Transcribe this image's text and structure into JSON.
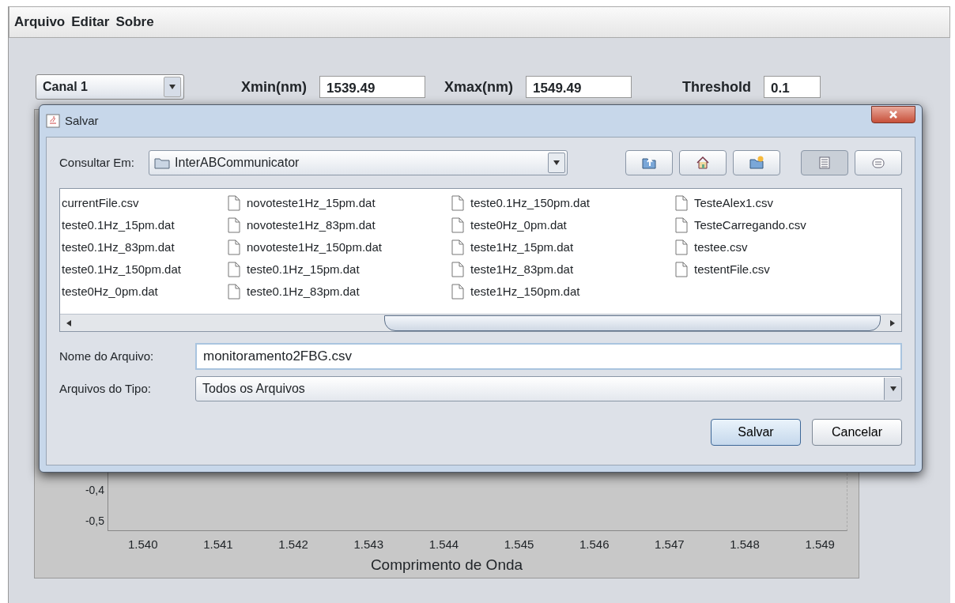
{
  "menu": [
    "Arquivo",
    "Editar",
    "Sobre"
  ],
  "controls": {
    "channel": "Canal 1",
    "fields": [
      {
        "label": "Xmin(nm)",
        "value": "1539.49"
      },
      {
        "label": "Xmax(nm)",
        "value": "1549.49"
      },
      {
        "label": "Threshold",
        "value": "0.1"
      }
    ]
  },
  "chart": {
    "yticks": [
      "-0,4",
      "-0,5"
    ],
    "xticks": [
      "1.540",
      "1.541",
      "1.542",
      "1.543",
      "1.544",
      "1.545",
      "1.546",
      "1.547",
      "1.548",
      "1.549"
    ],
    "xlabel": "Comprimento de Onda"
  },
  "dialog": {
    "title": "Salvar",
    "look_in_label": "Consultar Em:",
    "look_in": "InterABCommunicator",
    "toolbar_buttons": [
      {
        "kind": "up-folder",
        "selected": false
      },
      {
        "kind": "home",
        "selected": false
      },
      {
        "kind": "new-folder",
        "selected": false
      },
      {
        "kind": "list",
        "selected": true
      },
      {
        "kind": "details",
        "selected": false
      }
    ],
    "file_columns": [
      {
        "icons_shown": false,
        "files": [
          "currentFile.csv",
          "teste0.1Hz_15pm.dat",
          "teste0.1Hz_83pm.dat",
          "teste0.1Hz_150pm.dat",
          "teste0Hz_0pm.dat"
        ]
      },
      {
        "icons_shown": true,
        "files": [
          "novoteste1Hz_15pm.dat",
          "novoteste1Hz_83pm.dat",
          "novoteste1Hz_150pm.dat",
          "teste0.1Hz_15pm.dat",
          "teste0.1Hz_83pm.dat"
        ]
      },
      {
        "icons_shown": true,
        "files": [
          "teste0.1Hz_150pm.dat",
          "teste0Hz_0pm.dat",
          "teste1Hz_15pm.dat",
          "teste1Hz_83pm.dat",
          "teste1Hz_150pm.dat"
        ]
      },
      {
        "icons_shown": true,
        "files": [
          "TesteAlex1.csv",
          "TesteCarregando.csv",
          "testee.csv",
          "testentFile.csv"
        ]
      }
    ],
    "filename_label": "Nome do Arquivo:",
    "filename": "monitoramento2FBG.csv",
    "filetype_label": "Arquivos do Tipo:",
    "filetype": "Todos os Arquivos",
    "buttons": [
      {
        "label": "Salvar",
        "kind": "primary"
      },
      {
        "label": "Cancelar",
        "kind": "secondary"
      }
    ]
  }
}
